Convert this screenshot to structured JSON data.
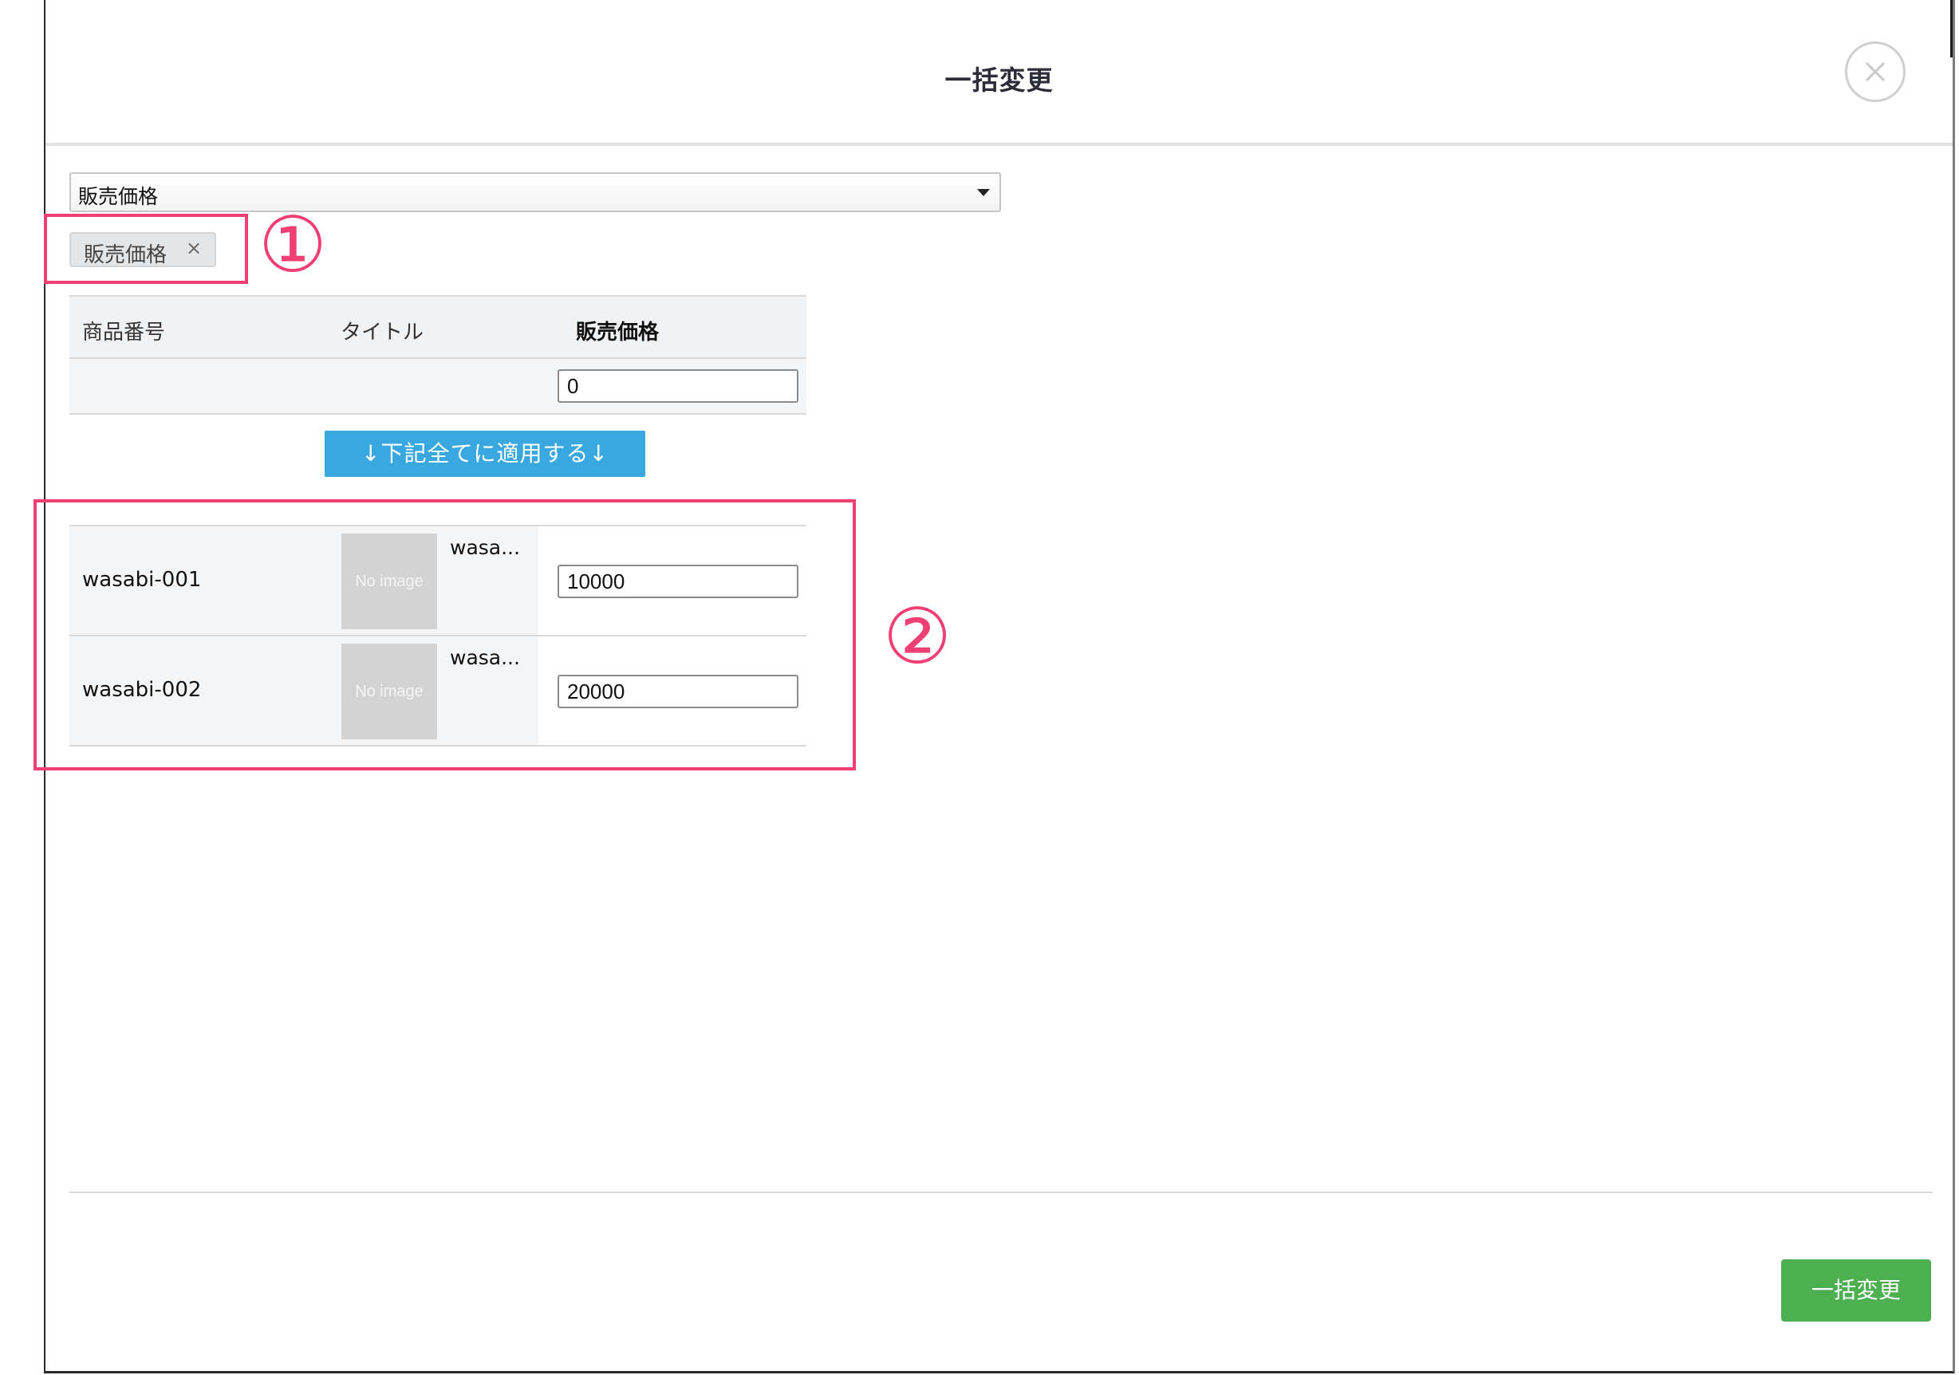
{
  "modal": {
    "title": "一括変更",
    "close_icon": "close-icon"
  },
  "field_select": {
    "selected": "販売価格"
  },
  "selected_tags": [
    {
      "label": "販売価格",
      "remove_label": "×"
    }
  ],
  "table": {
    "columns": [
      "商品番号",
      "タイトル",
      "販売価格"
    ],
    "bulk_input_value": "0"
  },
  "apply_button_label": "↓下記全てに適用する↓",
  "items": [
    {
      "code": "wasabi-001",
      "image_placeholder": "No image",
      "title": "wasa...",
      "price": "10000"
    },
    {
      "code": "wasabi-002",
      "image_placeholder": "No image",
      "title": "wasa...",
      "price": "20000"
    }
  ],
  "annotations": [
    "①",
    "②"
  ],
  "submit_button_label": "一括変更",
  "colors": {
    "accent_blue": "#3aa8e0",
    "submit_green": "#4caf50",
    "annotation_pink": "#ef3f73"
  }
}
